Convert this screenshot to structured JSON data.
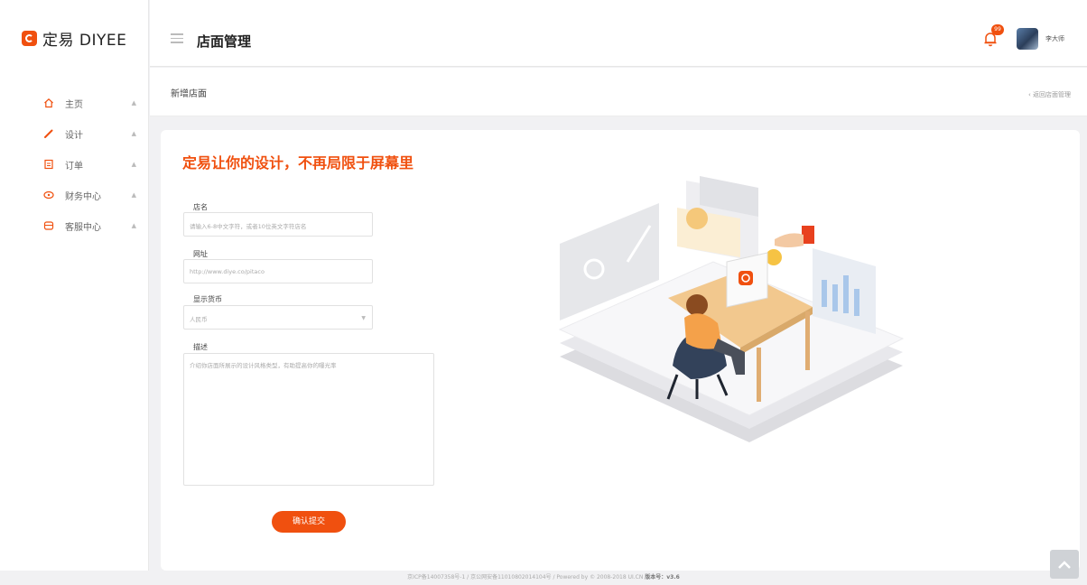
{
  "brand": {
    "name": "定易 DIYEE",
    "color": "#f0500f"
  },
  "sidebar": {
    "items": [
      {
        "label": "主页",
        "icon": "home-icon"
      },
      {
        "label": "设计",
        "icon": "pen-icon"
      },
      {
        "label": "订单",
        "icon": "order-icon"
      },
      {
        "label": "财务中心",
        "icon": "finance-icon"
      },
      {
        "label": "客服中心",
        "icon": "service-icon"
      }
    ]
  },
  "header": {
    "title": "店面管理",
    "notification_count": "99",
    "username": "李大师"
  },
  "subheader": {
    "title": "新增店面",
    "back_link": "返回店面管理"
  },
  "form": {
    "headline": "定易让你的设计，不再局限于屏幕里",
    "name": {
      "label": "店名",
      "placeholder": "请输入6-8中文字符，或者10位英文字符店名"
    },
    "url": {
      "label": "网址",
      "value": "http://www.diye.co/pitaco"
    },
    "currency": {
      "label": "显示货币",
      "value": "人民币"
    },
    "description": {
      "label": "描述",
      "placeholder": "介绍你店面所展示的设计风格类型，有助提高你的曝光率"
    },
    "submit_label": "确认提交"
  },
  "footer": {
    "text": "京ICP备14007358号-1 / 京公网安备11010802014104号 / Powered by © 2008-2018 UI.CN",
    "version_label": "版本号：v3.6"
  }
}
